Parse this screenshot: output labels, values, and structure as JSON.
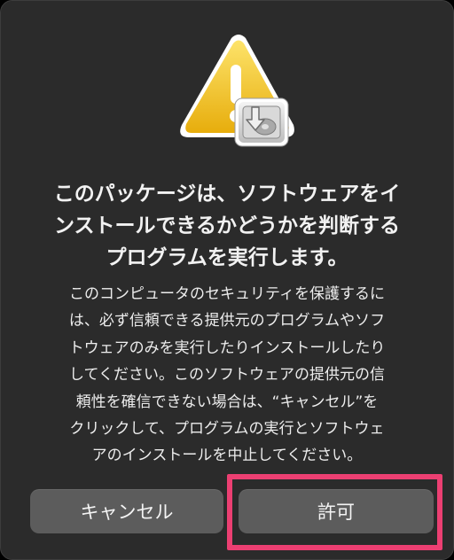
{
  "dialog": {
    "icon": "warning-triangle-with-installer-icon",
    "title_lines": [
      "このパッケージは、ソフトウェアをイ",
      "ンストールできるかどうかを判断する",
      "プログラムを実行します。"
    ],
    "body_lines": [
      "このコンピュータのセキュリティを保護するに",
      "は、必ず信頼できる提供元のプログラムやソフ",
      "トウェアのみを実行したりインストールしたり",
      "してください。このソフトウェアの提供元の信",
      "頼性を確信できない場合は、“キャンセル”を",
      "クリックして、プログラムの実行とソフトウェ",
      "アのインストールを中止してください。"
    ],
    "buttons": {
      "cancel": "キャンセル",
      "allow": "許可"
    }
  },
  "colors": {
    "dialog_bg": "#2b2b2b",
    "button_bg": "#5c5c5c",
    "highlight": "#ec3f72",
    "warning_yellow": "#f2c417"
  }
}
